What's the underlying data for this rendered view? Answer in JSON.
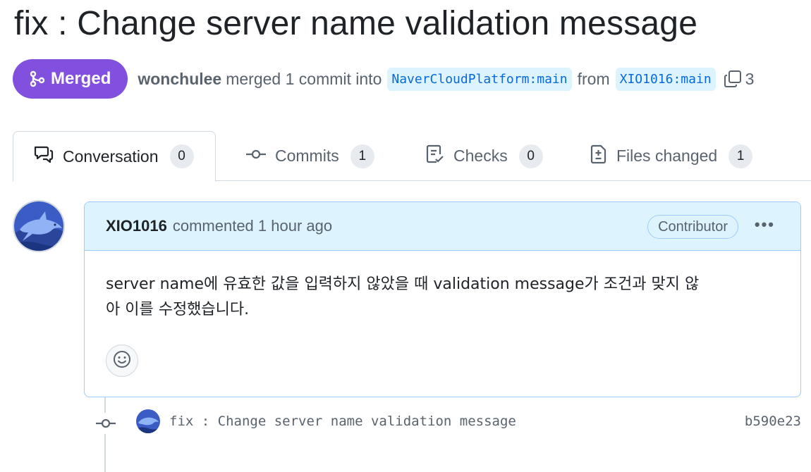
{
  "pr": {
    "title": "fix : Change server name validation message",
    "state_label": "Merged",
    "merged_by": "wonchulee",
    "merged_text": "merged 1 commit into",
    "base_branch": "NaverCloudPlatform:main",
    "from_text": "from",
    "head_branch": "XIO1016:main",
    "trailing_count": "3"
  },
  "tabs": [
    {
      "label": "Conversation",
      "count": "0",
      "icon": "conversation-icon",
      "active": true
    },
    {
      "label": "Commits",
      "count": "1",
      "icon": "git-commit-icon",
      "active": false
    },
    {
      "label": "Checks",
      "count": "0",
      "icon": "checklist-icon",
      "active": false
    },
    {
      "label": "Files changed",
      "count": "1",
      "icon": "file-diff-icon",
      "active": false
    }
  ],
  "comment": {
    "author": "XIO1016",
    "action": "commented 1 hour ago",
    "role_badge": "Contributor",
    "menu_icon": "kebab-horizontal-icon",
    "body_line1": "server name에 유효한 값을 입력하지 않았을 때 validation message가 조건과 맞지 않",
    "body_line2": "아 이를 수정했습니다.",
    "reaction_icon": "smiley-icon"
  },
  "commit": {
    "message": "fix : Change server name validation message",
    "sha": "b590e23"
  },
  "colors": {
    "merged": "#8250df",
    "accent_blue": "#0969da",
    "branch_bg": "#ddf4ff",
    "comment_header_bg": "#ddf4ff",
    "comment_border": "#9ecbff"
  }
}
